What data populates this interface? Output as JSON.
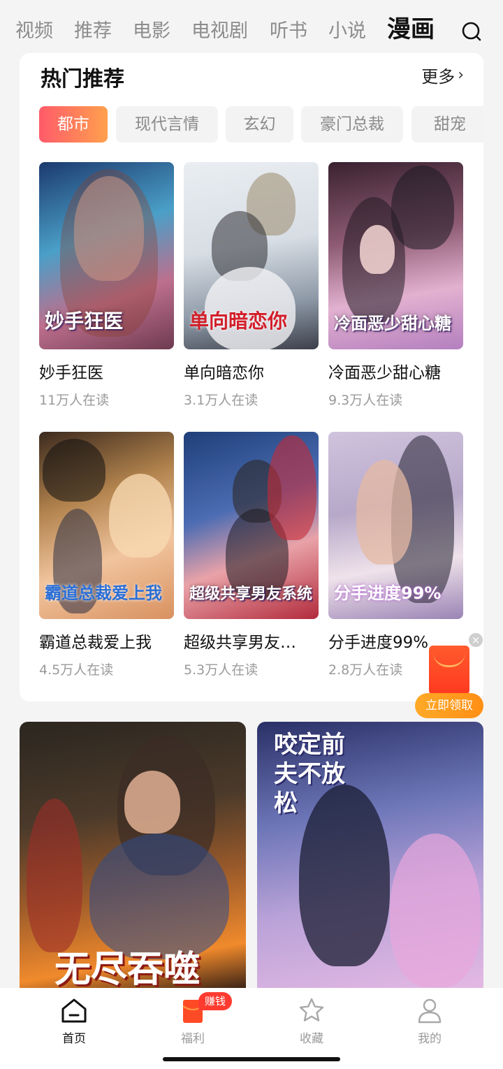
{
  "top_nav": {
    "items": [
      {
        "label": "视频"
      },
      {
        "label": "推荐"
      },
      {
        "label": "电影"
      },
      {
        "label": "电视剧"
      },
      {
        "label": "听书"
      },
      {
        "label": "小说"
      },
      {
        "label": "漫画",
        "active": true
      }
    ],
    "search_icon": "search-icon"
  },
  "hot_section": {
    "title": "热门推荐",
    "more_label": "更多",
    "tabs": [
      {
        "label": "都市",
        "active": true
      },
      {
        "label": "现代言情"
      },
      {
        "label": "玄幻"
      },
      {
        "label": "豪门总裁"
      },
      {
        "label": "甜宠"
      }
    ],
    "books": [
      {
        "title": "妙手狂医",
        "readers": "11万人在读",
        "cover_text": "妙手狂医"
      },
      {
        "title": "单向暗恋你",
        "readers": "3.1万人在读",
        "cover_text": "单向暗恋你"
      },
      {
        "title": "冷面恶少甜心糖",
        "readers": "9.3万人在读",
        "cover_text": "冷面恶少甜心糖"
      },
      {
        "title": "霸道总裁爱上我",
        "readers": "4.5万人在读",
        "cover_text": "霸道总裁爱上我"
      },
      {
        "title": "超级共享男友…",
        "readers": "5.3万人在读",
        "cover_text": "超级共享男友系统"
      },
      {
        "title": "分手进度99%",
        "readers": "2.8万人在读",
        "cover_text": "分手进度99%"
      }
    ]
  },
  "feed": [
    {
      "cover_text": "无尽吞噬"
    },
    {
      "cover_text": "咬定前夫不放松"
    }
  ],
  "float_packet": {
    "close_label": "×",
    "claim_label": "立即领取"
  },
  "tab_bar": {
    "items": [
      {
        "label": "首页",
        "icon": "home-icon",
        "active": true
      },
      {
        "label": "福利",
        "icon": "gift-icon"
      },
      {
        "label": "收藏",
        "icon": "star-icon"
      },
      {
        "label": "我的",
        "icon": "user-icon"
      }
    ],
    "earn_badge": "赚钱"
  },
  "colors": {
    "accent_start": "#ff5b6a",
    "accent_end": "#ffa04d",
    "badge_red": "#ff3b30",
    "claim_orange": "#ff9a1f"
  }
}
